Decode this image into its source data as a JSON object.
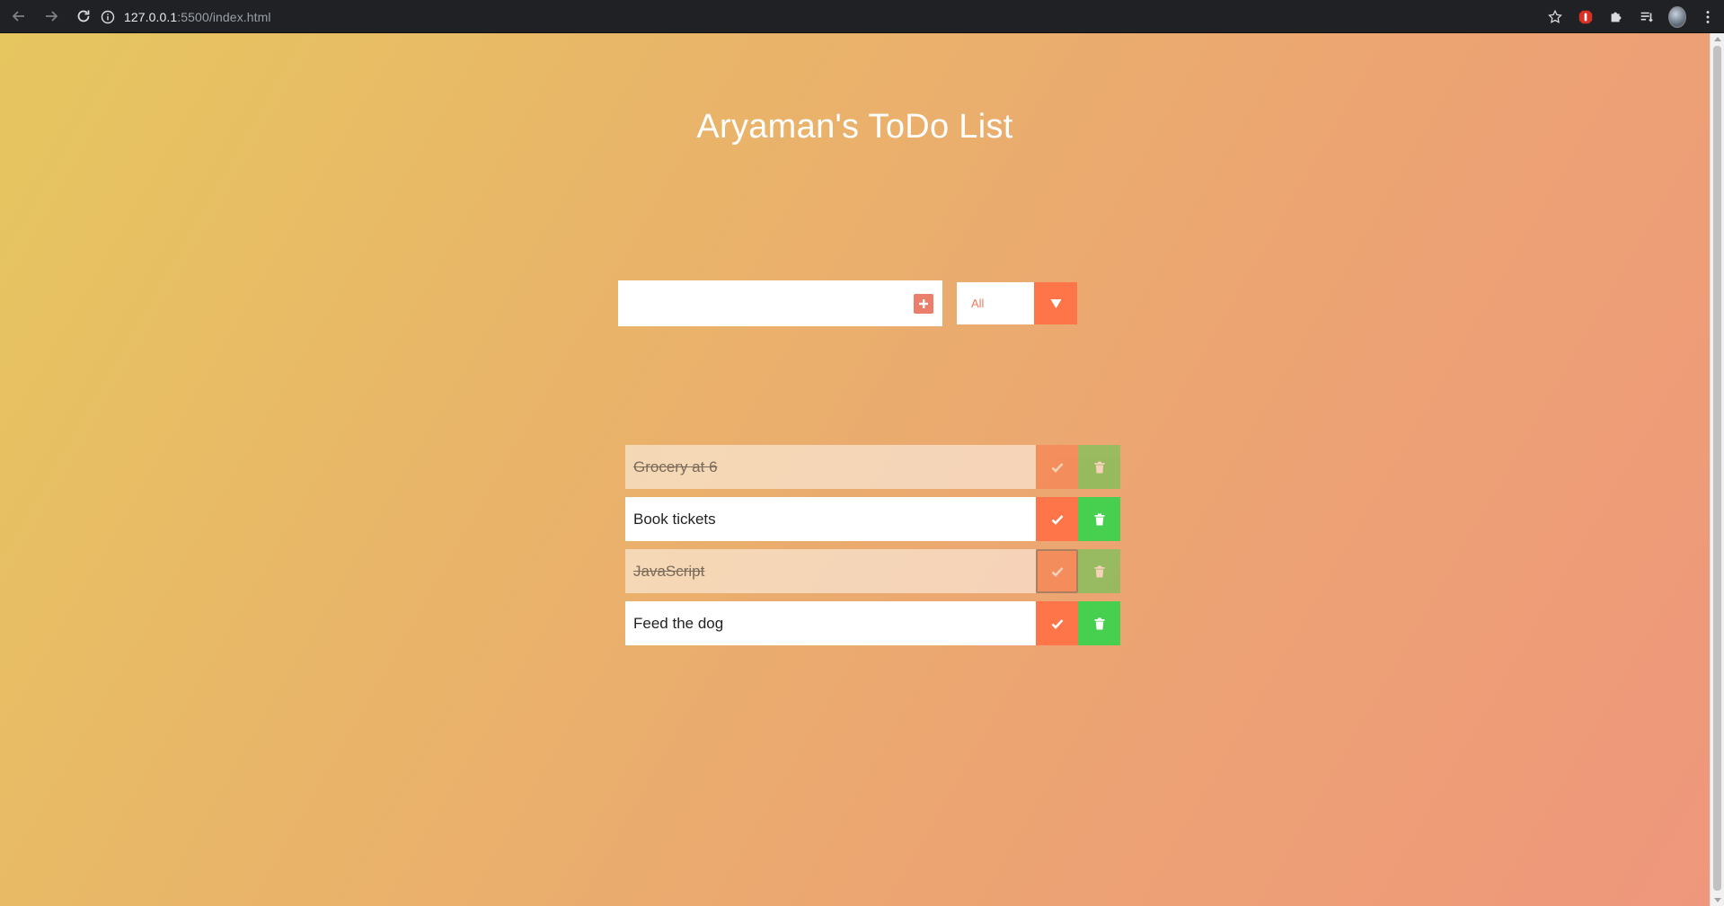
{
  "browser": {
    "url_host": "127.0.0.1",
    "url_rest": ":5500/index.html"
  },
  "page": {
    "title": "Aryaman's ToDo List"
  },
  "form": {
    "input_value": "",
    "filter_selected": "All"
  },
  "todos": [
    {
      "text": "Grocery at 6",
      "completed": true
    },
    {
      "text": "Book tickets",
      "completed": false
    },
    {
      "text": "JavaScript",
      "completed": true
    },
    {
      "text": "Feed the dog",
      "completed": false
    }
  ],
  "colors": {
    "complete_button": "#fd7548",
    "trash_button": "#47cf4f",
    "add_button": "#ec7e6c"
  }
}
